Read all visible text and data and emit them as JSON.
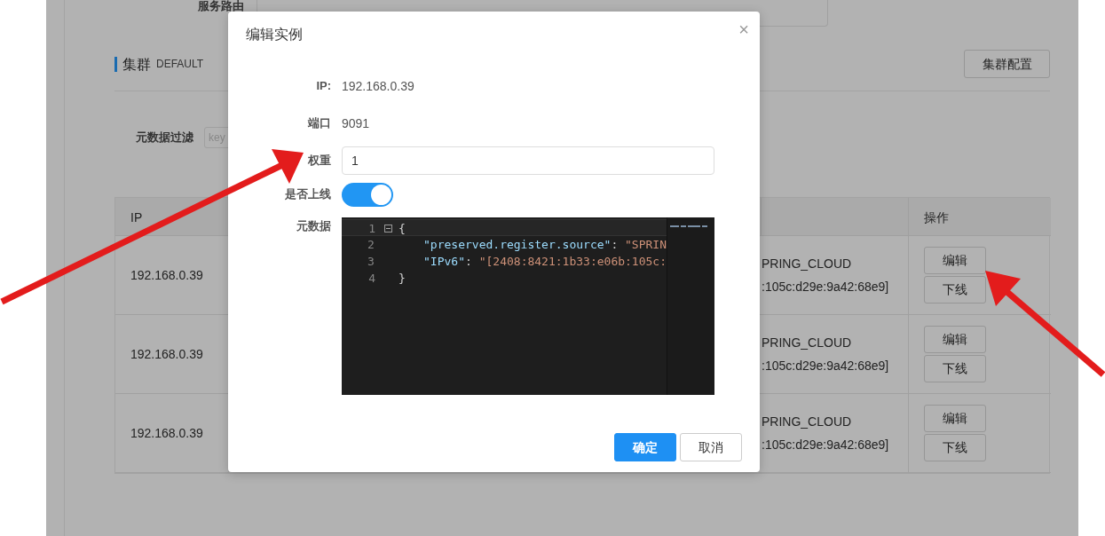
{
  "service": {
    "route_type_label": "服务路由"
  },
  "cluster": {
    "title": "集群",
    "name": "DEFAULT",
    "config_button": "集群配置"
  },
  "filter": {
    "label": "元数据过滤",
    "placeholder": "key"
  },
  "table": {
    "columns": [
      "IP",
      "操作"
    ],
    "rows": [
      {
        "ip": "192.168.0.39",
        "metadata_lines": [
          "PRING_CLOUD",
          ":105c:d29e:9a42:68e9]"
        ],
        "actions": [
          "编辑",
          "下线"
        ]
      },
      {
        "ip": "192.168.0.39",
        "metadata_lines": [
          "PRING_CLOUD",
          ":105c:d29e:9a42:68e9]"
        ],
        "actions": [
          "编辑",
          "下线"
        ]
      },
      {
        "ip": "192.168.0.39",
        "metadata_lines": [
          "PRING_CLOUD",
          ":105c:d29e:9a42:68e9]"
        ],
        "actions": [
          "编辑",
          "下线"
        ]
      }
    ]
  },
  "modal": {
    "title": "编辑实例",
    "close": "×",
    "fields": [
      {
        "kind": "text",
        "label": "IP:",
        "value": "192.168.0.39"
      },
      {
        "kind": "text",
        "label": "端口",
        "value": "9091"
      },
      {
        "kind": "input",
        "label": "权重",
        "value": "1"
      },
      {
        "kind": "switch",
        "label": "是否上线",
        "on": true
      },
      {
        "kind": "editor",
        "label": "元数据",
        "lines": [
          {
            "number": "1",
            "tokens": [
              {
                "kind": "punct",
                "text": "{"
              }
            ]
          },
          {
            "number": "2",
            "tokens": [
              {
                "kind": "key",
                "text": "\"preserved.register.source\""
              },
              {
                "kind": "punct",
                "text": ": "
              },
              {
                "kind": "string",
                "text": "\"SPRIN"
              }
            ]
          },
          {
            "number": "3",
            "tokens": [
              {
                "kind": "key",
                "text": "\"IPv6\""
              },
              {
                "kind": "punct",
                "text": ": "
              },
              {
                "kind": "string",
                "text": "\"[2408:8421:1b33:e06b:105c:"
              }
            ]
          },
          {
            "number": "4",
            "tokens": [
              {
                "kind": "punct",
                "text": "}"
              }
            ]
          }
        ]
      }
    ],
    "buttons": [
      {
        "label": "确定",
        "primary": true
      },
      {
        "label": "取消",
        "primary": false
      }
    ]
  }
}
